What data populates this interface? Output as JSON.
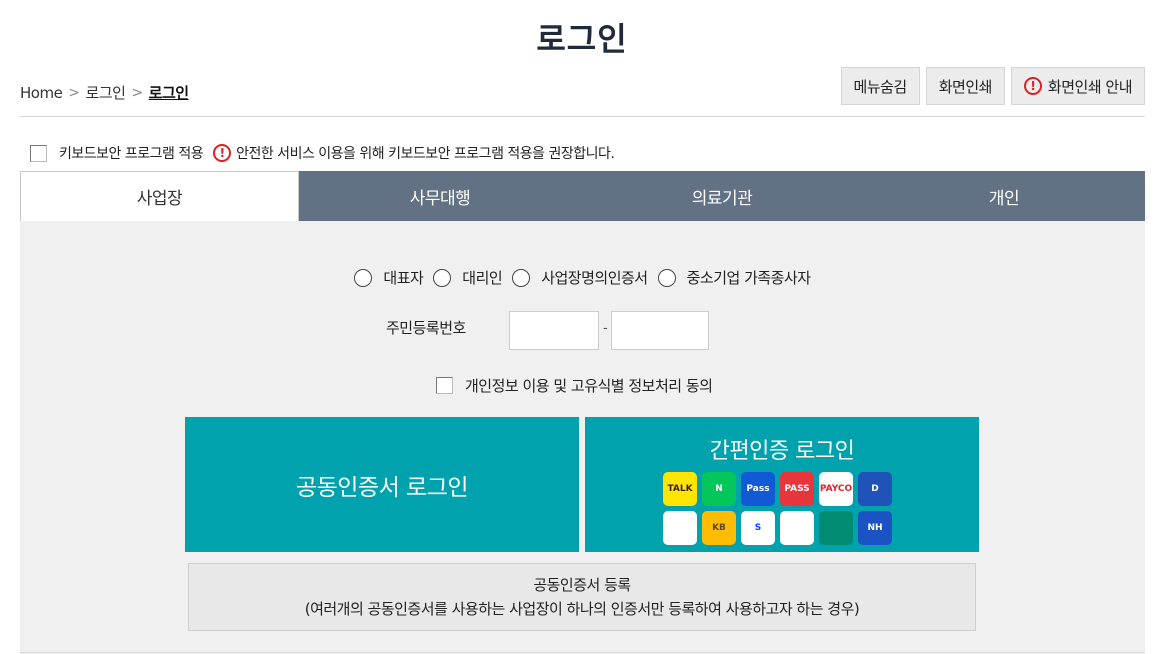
{
  "page": {
    "title": "로그인"
  },
  "breadcrumb": {
    "home": "Home",
    "level1": "로그인",
    "current": "로그인"
  },
  "top_buttons": {
    "hide_menu": "메뉴숨김",
    "print": "화면인쇄",
    "print_guide": "화면인쇄 안내"
  },
  "keyboard_security": {
    "label": "키보드보안 프로그램 적용",
    "notice": "안전한 서비스 이용을 위해 키보드보안 프로그램 적용을 권장합니다."
  },
  "tabs": [
    {
      "label": "사업장",
      "active": true
    },
    {
      "label": "사무대행",
      "active": false
    },
    {
      "label": "의료기관",
      "active": false
    },
    {
      "label": "개인",
      "active": false
    }
  ],
  "login_type_options": [
    "대표자",
    "대리인",
    "사업장명의인증서",
    "중소기업 가족종사자"
  ],
  "rrn": {
    "label": "주민등록번호",
    "dash": "-"
  },
  "agree": {
    "label": "개인정보 이용 및 고유식별 정보처리 동의"
  },
  "buttons": {
    "cert_login": "공동인증서 로그인",
    "simple_login": "간편인증 로그인",
    "register_title": "공동인증서 등록",
    "register_desc": "(여러개의 공동인증서를 사용하는 사업장이 하나의 인증서만 등록하여 사용하고자 하는 경우)"
  },
  "simple_auth_apps": [
    {
      "icon": "kakao-talk-icon",
      "text": "TALK",
      "bg": "#fee500",
      "fg": "#3a1d1d"
    },
    {
      "icon": "naver-icon",
      "text": "N",
      "bg": "#03c75a",
      "fg": "#ffffff"
    },
    {
      "icon": "samsung-pass-icon",
      "text": "Pass",
      "bg": "#1259d6",
      "fg": "#ffffff"
    },
    {
      "icon": "pass-icon",
      "text": "PASS",
      "bg": "#e8343b",
      "fg": "#ffffff"
    },
    {
      "icon": "payco-icon",
      "text": "PAYCO",
      "bg": "#ffffff",
      "fg": "#e2202c"
    },
    {
      "icon": "digital-id-icon",
      "text": "D",
      "bg": "#1f53b8",
      "fg": "#ffffff"
    },
    {
      "icon": "toss-icon",
      "text": "",
      "bg": "#ffffff",
      "fg": "#0064ff"
    },
    {
      "icon": "kb-bank-icon",
      "text": "KB",
      "bg": "#ffbc00",
      "fg": "#5a4a2a"
    },
    {
      "icon": "shinhan-bank-icon",
      "text": "S",
      "bg": "#ffffff",
      "fg": "#0046ff"
    },
    {
      "icon": "woori-icon",
      "text": "",
      "bg": "#ffffff",
      "fg": "#1bb38f"
    },
    {
      "icon": "hana-bank-icon",
      "text": "",
      "bg": "#008c73",
      "fg": "#ffffff"
    },
    {
      "icon": "nh-bank-icon",
      "text": "NH",
      "bg": "#1b53c4",
      "fg": "#ffffff"
    }
  ]
}
